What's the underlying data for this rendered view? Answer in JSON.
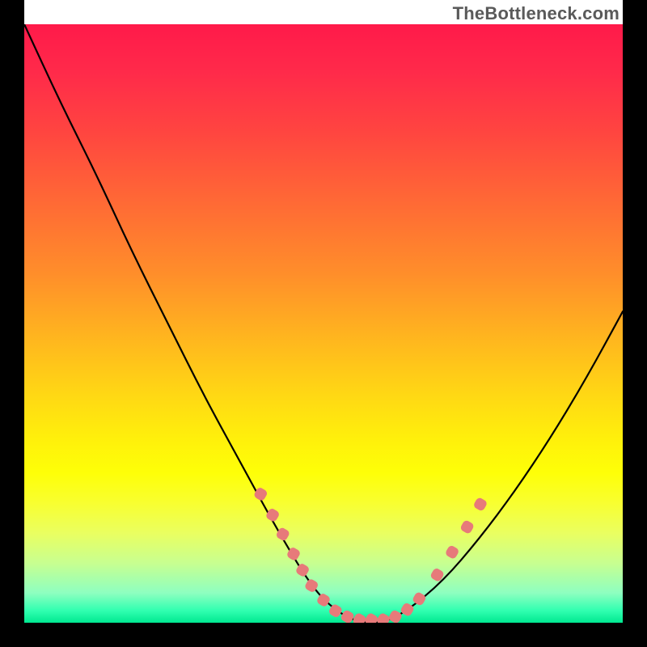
{
  "watermark": "TheBottleneck.com",
  "chart_data": {
    "type": "line",
    "title": "",
    "xlabel": "",
    "ylabel": "",
    "xlim": [
      0,
      1
    ],
    "ylim": [
      0,
      1
    ],
    "series": [
      {
        "name": "curve",
        "x": [
          0.0,
          0.06,
          0.12,
          0.18,
          0.24,
          0.3,
          0.36,
          0.42,
          0.48,
          0.52,
          0.56,
          0.6,
          0.64,
          0.7,
          0.76,
          0.82,
          0.88,
          0.94,
          1.0
        ],
        "y": [
          1.0,
          0.87,
          0.75,
          0.62,
          0.5,
          0.38,
          0.27,
          0.16,
          0.06,
          0.02,
          0.0,
          0.0,
          0.02,
          0.07,
          0.14,
          0.22,
          0.31,
          0.41,
          0.52
        ]
      }
    ],
    "highlight_segments": {
      "name": "flank-markers",
      "color": "#e77a7a",
      "points": [
        {
          "x": 0.395,
          "y": 0.215
        },
        {
          "x": 0.415,
          "y": 0.18
        },
        {
          "x": 0.432,
          "y": 0.148
        },
        {
          "x": 0.45,
          "y": 0.115
        },
        {
          "x": 0.465,
          "y": 0.088
        },
        {
          "x": 0.48,
          "y": 0.062
        },
        {
          "x": 0.5,
          "y": 0.038
        },
        {
          "x": 0.52,
          "y": 0.02
        },
        {
          "x": 0.54,
          "y": 0.01
        },
        {
          "x": 0.56,
          "y": 0.005
        },
        {
          "x": 0.58,
          "y": 0.005
        },
        {
          "x": 0.6,
          "y": 0.005
        },
        {
          "x": 0.62,
          "y": 0.01
        },
        {
          "x": 0.64,
          "y": 0.022
        },
        {
          "x": 0.66,
          "y": 0.04
        },
        {
          "x": 0.69,
          "y": 0.08
        },
        {
          "x": 0.715,
          "y": 0.118
        },
        {
          "x": 0.74,
          "y": 0.16
        },
        {
          "x": 0.762,
          "y": 0.198
        }
      ]
    },
    "background_gradient": {
      "top": "#ff1a4a",
      "mid": "#fff20a",
      "bottom": "#00e890"
    }
  }
}
